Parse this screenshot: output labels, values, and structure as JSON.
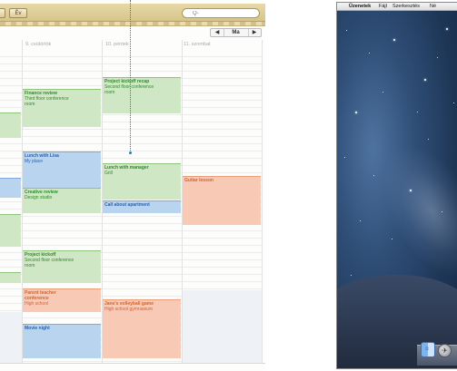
{
  "calendar": {
    "toolbar": {
      "button_primary": "",
      "button_secondary": "Év",
      "search_placeholder": "Q-"
    },
    "nav": {
      "prev": "◀",
      "today": "Ma",
      "next": "▶"
    },
    "day_headers": [
      "9. csütörtök",
      "10. péntek",
      "11. szombat"
    ],
    "events": [
      {
        "id": "finance",
        "title": "Finance review",
        "sub1": "Third floor conference",
        "sub2": "room",
        "color": "green"
      },
      {
        "id": "kickoff-recap",
        "title": "Project kickoff recap",
        "sub1": "Second floor conference",
        "sub2": "room",
        "color": "green"
      },
      {
        "id": "lunch-lisa",
        "title": "Lunch with Lisa",
        "sub1": "My place",
        "sub2": "",
        "color": "blue"
      },
      {
        "id": "lunch-manager",
        "title": "Lunch with manager",
        "sub1": "Grill",
        "sub2": "",
        "color": "green"
      },
      {
        "id": "guitar",
        "title": "Guitar lesson",
        "sub1": "",
        "sub2": "",
        "color": "orange"
      },
      {
        "id": "creative",
        "title": "Creative review",
        "sub1": "Design studio",
        "sub2": "",
        "color": "green"
      },
      {
        "id": "apartment",
        "title": "Call about apartment",
        "sub1": "",
        "sub2": "",
        "color": "blue"
      },
      {
        "id": "kickoff",
        "title": "Project kickoff",
        "sub1": "Second floor conference",
        "sub2": "room",
        "color": "green"
      },
      {
        "id": "parent",
        "title": "Parent teacher",
        "sub1": "conference",
        "sub2": "High school",
        "color": "orange"
      },
      {
        "id": "volleyball",
        "title": "Jane's volleyball game",
        "sub1": "High school gymnasium",
        "sub2": "",
        "color": "orange"
      },
      {
        "id": "movie",
        "title": "Movie night",
        "sub1": "",
        "sub2": "",
        "color": "blue"
      }
    ]
  },
  "desktop": {
    "menubar": {
      "apple": "",
      "app_name": "Üzenetek",
      "menu_file": "Fájl",
      "menu_edit": "Szerkesztés",
      "menu_partial": "Né"
    }
  },
  "colors": {
    "event_green": "#cfe7c4",
    "event_blue": "#b9d4ee",
    "event_orange": "#f8c9b4",
    "callout": "#0a86c9"
  }
}
